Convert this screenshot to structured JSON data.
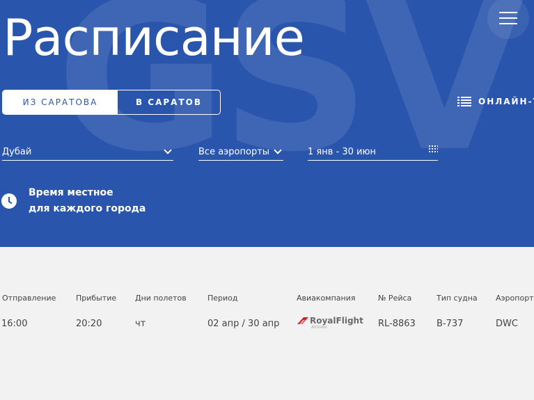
{
  "header": {
    "watermark": "GSV",
    "title": "Расписание"
  },
  "direction_toggle": {
    "from_label": "ИЗ САРАТОВА",
    "to_label": "В САРАТОВ",
    "active": "from"
  },
  "online_board_label": "ОНЛАЙН-ТА",
  "filters": {
    "city": "Дубай",
    "airports": "Все аэропорты",
    "date_range": "1 янв - 30 июн"
  },
  "note": {
    "line1": "Время местное",
    "line2": "для каждого города"
  },
  "table": {
    "columns": [
      "Отправление",
      "Прибытие",
      "Дни полетов",
      "Период",
      "Авиакомпания",
      "№ Рейса",
      "Тип судна",
      "Аэропорт"
    ],
    "rows": [
      {
        "departure": "16:00",
        "arrival": "20:20",
        "days": "чт",
        "period": "02 апр / 30 апр",
        "airline": {
          "name": "RoyalFlight",
          "sub": "Airlines"
        },
        "flight_no": "RL-8863",
        "aircraft": "B-737",
        "airport": "DWC"
      }
    ]
  },
  "colors": {
    "hero_bg": "#2a55ad",
    "page_bg": "#f2f2f2",
    "airline_accent": "#d3232a"
  },
  "icons": {
    "menu": "hamburger-icon",
    "online_board": "list-icon",
    "dropdown": "chevron-down-icon",
    "calendar": "calendar-icon",
    "clock": "clock-icon"
  }
}
